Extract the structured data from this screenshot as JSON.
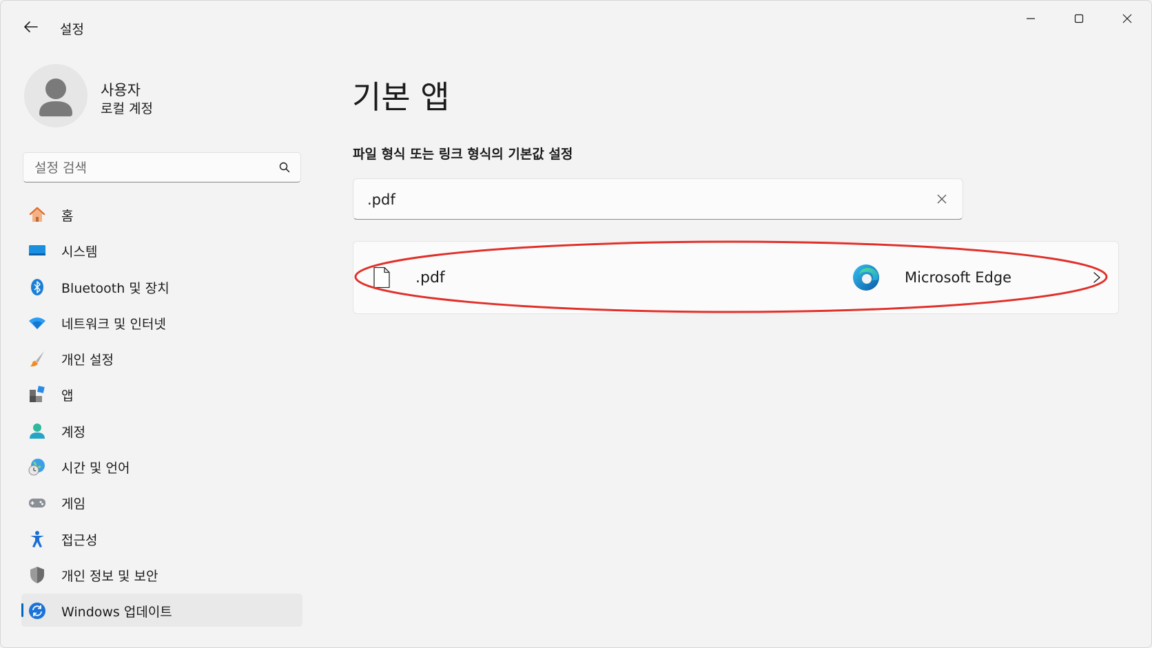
{
  "window": {
    "title": "설정"
  },
  "user": {
    "name": "사용자",
    "account_type": "로컬 계정"
  },
  "search": {
    "placeholder": "설정 검색"
  },
  "sidebar": {
    "items": [
      {
        "label": "홈",
        "icon": "home-icon"
      },
      {
        "label": "시스템",
        "icon": "system-icon"
      },
      {
        "label": "Bluetooth 및 장치",
        "icon": "bluetooth-icon"
      },
      {
        "label": "네트워크 및 인터넷",
        "icon": "wifi-icon"
      },
      {
        "label": "개인 설정",
        "icon": "brush-icon"
      },
      {
        "label": "앱",
        "icon": "apps-icon"
      },
      {
        "label": "계정",
        "icon": "person-icon"
      },
      {
        "label": "시간 및 언어",
        "icon": "globe-clock-icon"
      },
      {
        "label": "게임",
        "icon": "gamepad-icon"
      },
      {
        "label": "접근성",
        "icon": "accessibility-icon"
      },
      {
        "label": "개인 정보 및 보안",
        "icon": "shield-icon"
      },
      {
        "label": "Windows 업데이트",
        "icon": "update-icon",
        "selected": true
      }
    ]
  },
  "main": {
    "title": "기본 앱",
    "section_label": "파일 형식 또는 링크 형식의 기본값 설정",
    "filter_value": ".pdf",
    "result": {
      "extension": ".pdf",
      "app_name": "Microsoft Edge"
    }
  },
  "colors": {
    "accent": "#0067c0",
    "highlight": "#e0302a"
  }
}
